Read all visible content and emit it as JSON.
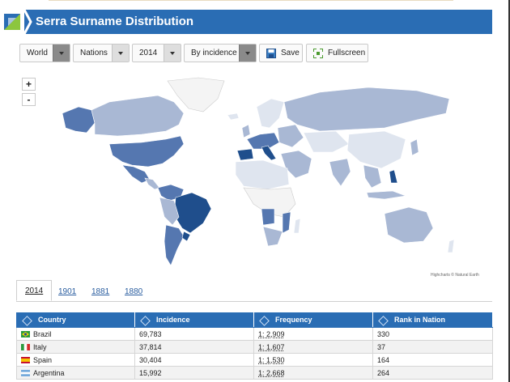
{
  "header": {
    "title": "Serra Surname Distribution"
  },
  "controls": {
    "scope": "World",
    "level": "Nations",
    "year": "2014",
    "metric": "By incidence",
    "save_label": "Save",
    "fullscreen_label": "Fullscreen"
  },
  "map": {
    "zoom_in": "+",
    "zoom_out": "-",
    "credit": "Highcharts © Natural Earth",
    "colors": {
      "dark": "#1f4e8c",
      "mid": "#5577b0",
      "light": "#a9b8d4",
      "pale": "#dfe5ef",
      "empty": "#f4f4f4"
    }
  },
  "tabs": [
    "2014",
    "1901",
    "1881",
    "1880"
  ],
  "table": {
    "headers": [
      "Country",
      "Incidence",
      "Frequency",
      "Rank in Nation"
    ],
    "rows": [
      {
        "country": "Brazil",
        "incidence": "69,783",
        "frequency": "1: 2,909",
        "rank": "330"
      },
      {
        "country": "Italy",
        "incidence": "37,814",
        "frequency": "1: 1,607",
        "rank": "37"
      },
      {
        "country": "Spain",
        "incidence": "30,404",
        "frequency": "1: 1,530",
        "rank": "164"
      },
      {
        "country": "Argentina",
        "incidence": "15,992",
        "frequency": "1: 2,668",
        "rank": "264"
      }
    ]
  }
}
